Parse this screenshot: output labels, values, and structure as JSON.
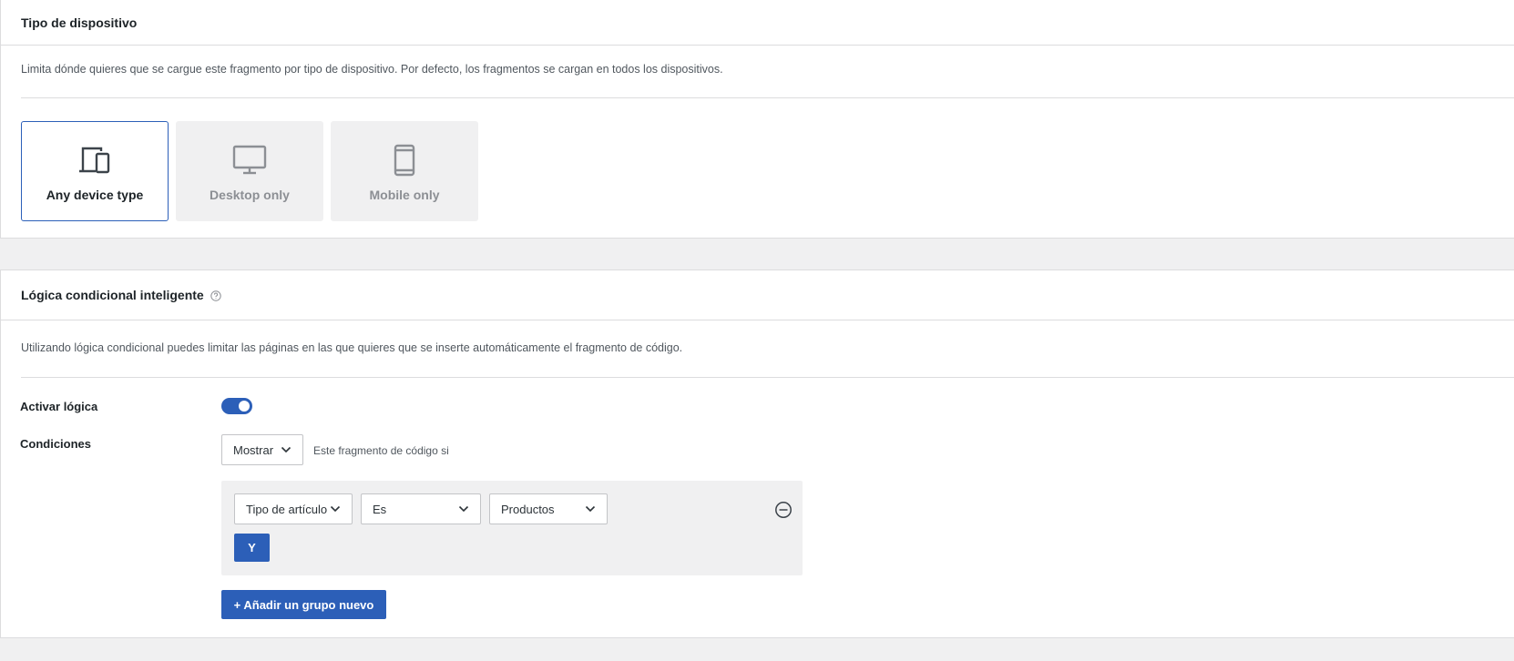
{
  "device_section": {
    "title": "Tipo de dispositivo",
    "description": "Limita dónde quieres que se cargue este fragmento por tipo de dispositivo. Por defecto, los fragmentos se cargan en todos los dispositivos.",
    "options": [
      {
        "label": "Any device type",
        "icon": "any-device-icon",
        "selected": true
      },
      {
        "label": "Desktop only",
        "icon": "desktop-icon",
        "selected": false
      },
      {
        "label": "Mobile only",
        "icon": "mobile-icon",
        "selected": false
      }
    ]
  },
  "logic_section": {
    "title": "Lógica condicional inteligente",
    "help_icon": "help-icon",
    "description": "Utilizando lógica condicional puedes limitar las páginas en las que quieres que se inserte automáticamente el fragmento de código.",
    "enable_label": "Activar lógica",
    "enable_value": true,
    "conditions_label": "Condiciones",
    "show_select": "Mostrar",
    "show_text": "Este fragmento de código si",
    "group": {
      "type_select": "Tipo de artículo",
      "operator_select": "Es",
      "value_select": "Productos",
      "and_button": "Y"
    },
    "add_group_button": "+ Añadir un grupo nuevo"
  },
  "colors": {
    "accent": "#2c5fb8",
    "background": "#f0f0f1",
    "border": "#dcdcde"
  }
}
